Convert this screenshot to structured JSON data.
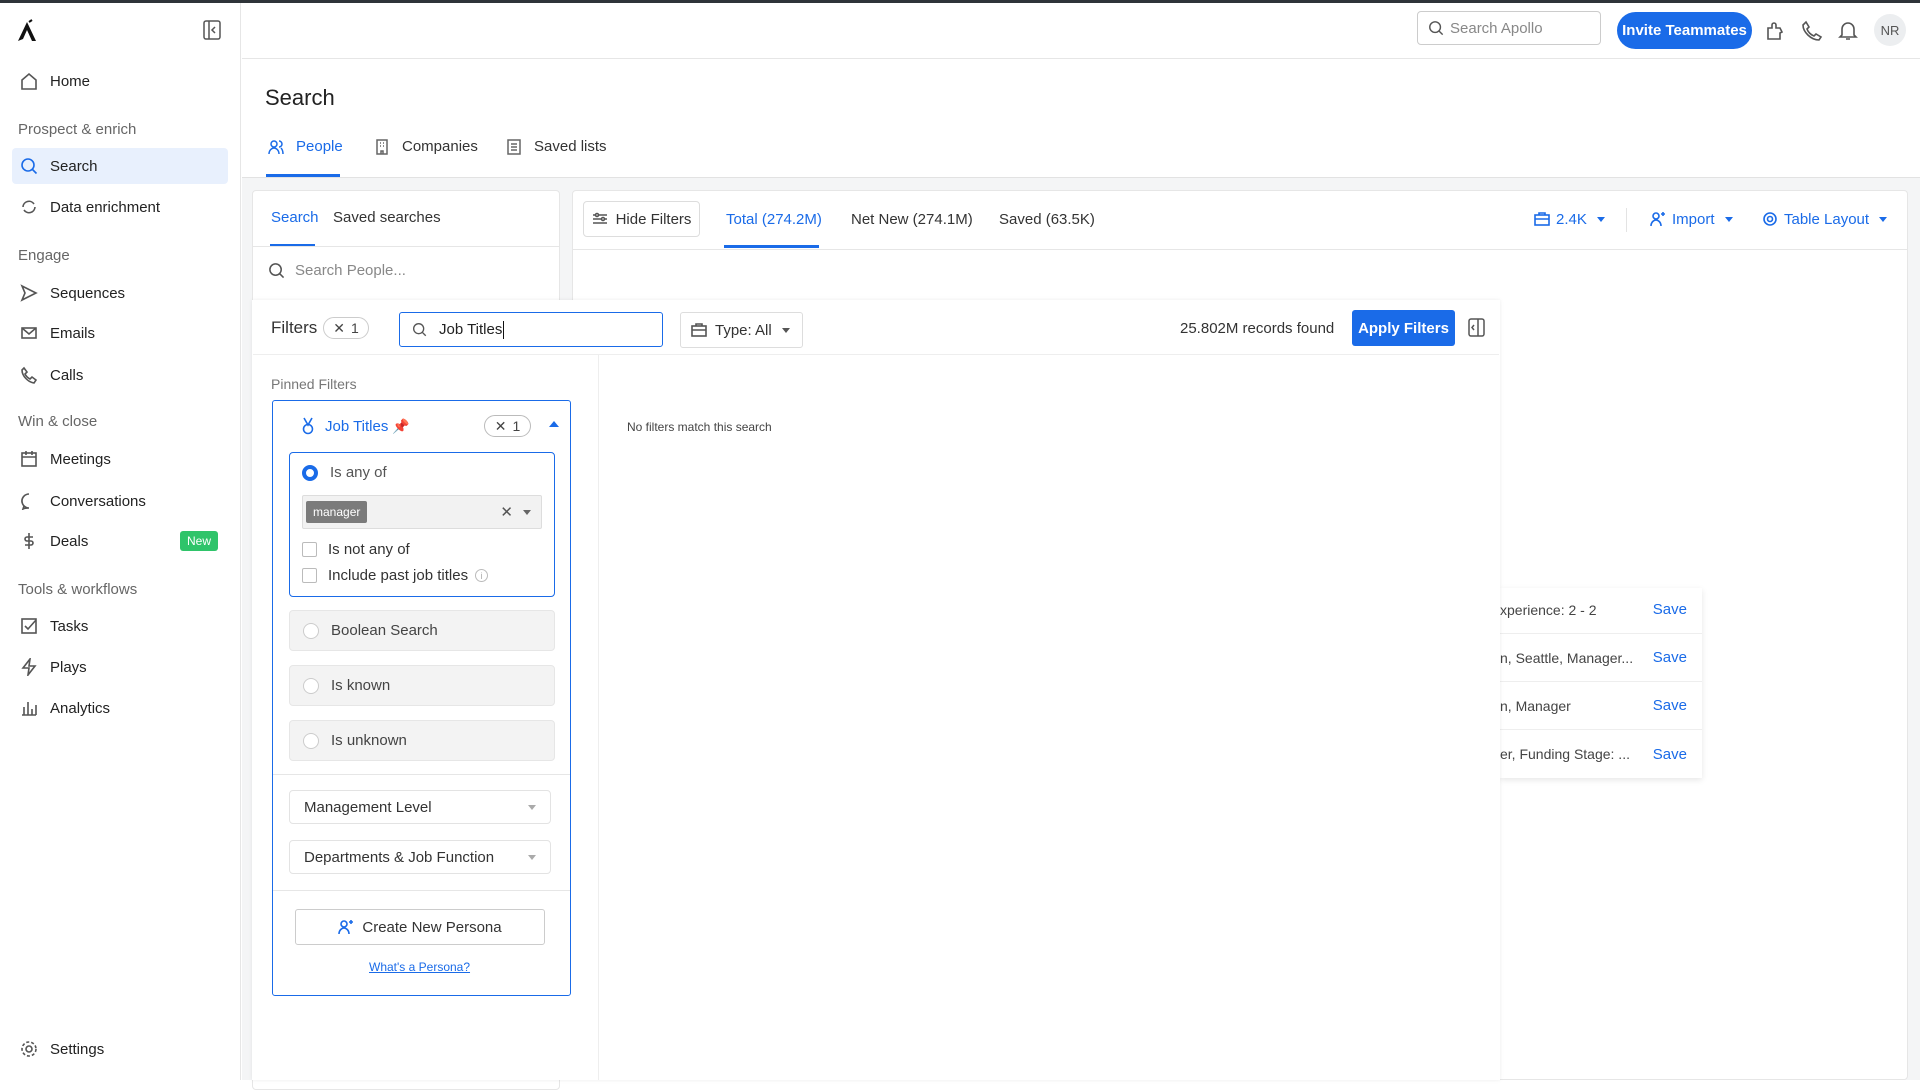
{
  "sidebar": {
    "items": {
      "home": "Home",
      "search": "Search",
      "data_enrichment": "Data enrichment",
      "sequences": "Sequences",
      "emails": "Emails",
      "calls": "Calls",
      "meetings": "Meetings",
      "conversations": "Conversations",
      "deals": "Deals",
      "deals_badge": "New",
      "tasks": "Tasks",
      "plays": "Plays",
      "analytics": "Analytics",
      "settings": "Settings"
    },
    "sections": {
      "prospect": "Prospect & enrich",
      "engage": "Engage",
      "win": "Win & close",
      "tools": "Tools & workflows"
    }
  },
  "header": {
    "search_placeholder": "Search Apollo",
    "invite_label": "Invite Teammates",
    "avatar_initials": "NR"
  },
  "page": {
    "title": "Search",
    "tabs": [
      "People",
      "Companies",
      "Saved lists"
    ],
    "active_tab": "People"
  },
  "left_panel": {
    "tabs": [
      "Search",
      "Saved searches"
    ],
    "search_placeholder": "Search People..."
  },
  "toolbar": {
    "hide_filters": "Hide Filters",
    "tabs": [
      "Total (274.2M)",
      "Net New (274.1M)",
      "Saved (63.5K)"
    ],
    "credits": "2.4K",
    "import": "Import",
    "table_layout": "Table Layout"
  },
  "filters": {
    "title": "Filters",
    "count": "1",
    "search_value": "Job Titles",
    "type_label": "Type: All",
    "records": "25.802M records found",
    "apply": "Apply Filters",
    "pinned_label": "Pinned Filters",
    "no_match": "No filters match this search",
    "job_titles": {
      "label": "Job Titles",
      "count": "1",
      "is_any_of": "Is any of",
      "tag": "manager",
      "is_not_any_of": "Is not any of",
      "include_past": "Include past job titles",
      "boolean": "Boolean Search",
      "is_known": "Is known",
      "is_unknown": "Is unknown"
    },
    "management_level": "Management Level",
    "departments": "Departments & Job Function",
    "create_persona": "Create New Persona",
    "whats_persona": "What's a Persona?"
  },
  "saved_searches": [
    {
      "text": "xperience: 2 - 2",
      "action": "Save"
    },
    {
      "text": "n, Seattle, Manager...",
      "action": "Save"
    },
    {
      "text": "n, Manager",
      "action": "Save"
    },
    {
      "text": "er, Funding Stage: ...",
      "action": "Save"
    }
  ],
  "colors": {
    "accent": "#1a6be8",
    "new_badge": "#2fc46a",
    "pin": "#f5b800"
  }
}
